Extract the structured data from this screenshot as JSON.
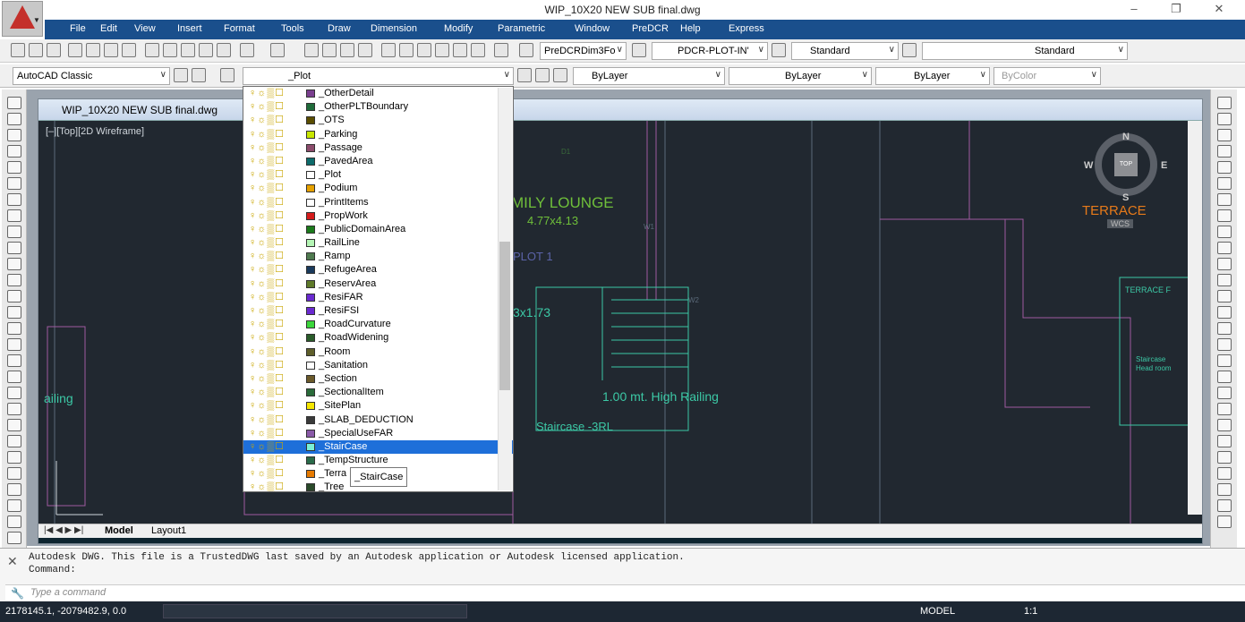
{
  "app": {
    "title": "WIP_10X20 NEW SUB final.dwg"
  },
  "menus": [
    "File",
    "Edit",
    "View",
    "Insert",
    "Format",
    "Tools",
    "Draw",
    "Dimension",
    "Modify",
    "Parametric",
    "Window",
    "PreDCR",
    "Help",
    "Express"
  ],
  "toolbar": {
    "dimstyle": "PreDCRDim3Fo",
    "plotstyle": "PDCR-PLOT-IN'",
    "textstyle": "Standard",
    "tablestyle": "Standard",
    "workspace": "AutoCAD Classic",
    "layer_current": "_Plot",
    "color": "ByLayer",
    "linetype": "ByLayer",
    "lineweight": "ByLayer",
    "plot_style_color": "ByColor"
  },
  "drawing": {
    "window_title": "WIP_10X20 NEW SUB final.dwg",
    "viewport_label": "[–][Top][2D Wireframe]",
    "texts": {
      "lounge": "MILY LOUNGE",
      "lounge_size": "4.77x4.13",
      "plot": "PLOT 1",
      "dim": "3x1.73",
      "railing": "1.00 mt. High Railing",
      "staircase": "Staircase -3RL",
      "railing_left": "ailing",
      "terrace": "TERRACE",
      "terrace_f": "TERRACE F",
      "staircase_head": "Staircase Head room",
      "w1": "W1",
      "w2": "W2",
      "d1": "D1"
    },
    "viewcube": {
      "n": "N",
      "s": "S",
      "e": "E",
      "w": "W",
      "top": "TOP",
      "wcs": "WCS"
    },
    "tabs": [
      "Model",
      "Layout1"
    ]
  },
  "layers": [
    {
      "name": "_OtherDetail",
      "color": "#7a3f8f"
    },
    {
      "name": "_OtherPLTBoundary",
      "color": "#1f6b3a"
    },
    {
      "name": "_OTS",
      "color": "#5a4d00"
    },
    {
      "name": "_Parking",
      "color": "#c8e600"
    },
    {
      "name": "_Passage",
      "color": "#8c4c6c"
    },
    {
      "name": "_PavedArea",
      "color": "#0d6b6b"
    },
    {
      "name": "_Plot",
      "color": "#ffffff"
    },
    {
      "name": "_Podium",
      "color": "#e6a100"
    },
    {
      "name": "_PrintItems",
      "color": "#ffffff"
    },
    {
      "name": "_PropWork",
      "color": "#d51b1b"
    },
    {
      "name": "_PublicDomainArea",
      "color": "#1b7a1b"
    },
    {
      "name": "_RailLine",
      "color": "#b5f5b5"
    },
    {
      "name": "_Ramp",
      "color": "#4f7a4f"
    },
    {
      "name": "_RefugeArea",
      "color": "#1a3a5c"
    },
    {
      "name": "_ReservArea",
      "color": "#5f7a2a"
    },
    {
      "name": "_ResiFAR",
      "color": "#6a2ad0"
    },
    {
      "name": "_ResiFSI",
      "color": "#6a2ad0"
    },
    {
      "name": "_RoadCurvature",
      "color": "#3bd63b"
    },
    {
      "name": "_RoadWidening",
      "color": "#2a5c2a"
    },
    {
      "name": "_Room",
      "color": "#5e5e2a"
    },
    {
      "name": "_Sanitation",
      "color": "#ffffff"
    },
    {
      "name": "_Section",
      "color": "#6b5a2a"
    },
    {
      "name": "_SectionalItem",
      "color": "#2a6b3a"
    },
    {
      "name": "_SitePlan",
      "color": "#f5e600"
    },
    {
      "name": "_SLAB_DEDUCTION",
      "color": "#3a3a3a"
    },
    {
      "name": "_SpecialUseFAR",
      "color": "#8a5aa8"
    },
    {
      "name": "_StairCase",
      "color": "#7af0d6"
    },
    {
      "name": "_TempStructure",
      "color": "#2a6b4a"
    },
    {
      "name": "_Terra",
      "color": "#e67a00"
    },
    {
      "name": "_Tree",
      "color": "#2a4a2a"
    }
  ],
  "selected_layer": "_StairCase",
  "tooltip": "_StairCase",
  "command": {
    "history": "Autodesk DWG.  This file is a TrustedDWG last saved by an Autodesk application or Autodesk licensed application.",
    "prompt": "Command:",
    "placeholder": "Type a command"
  },
  "status": {
    "coords": "2178145.1, -2079482.9, 0.0",
    "model": "MODEL",
    "scale": "1:1"
  }
}
